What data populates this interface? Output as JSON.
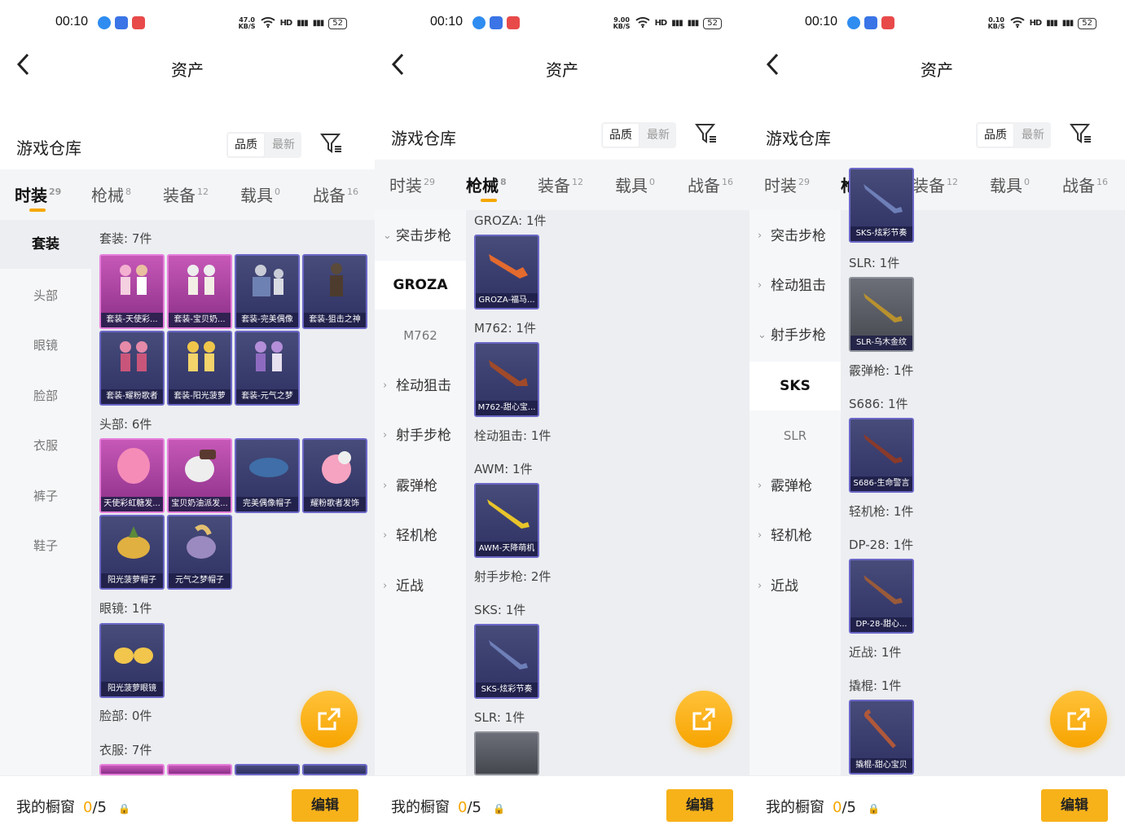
{
  "screens": [
    {
      "time": "00:10",
      "net": [
        "47.0",
        "KB/S"
      ],
      "battery": "52",
      "title": "资产",
      "warehouse": "游戏仓库",
      "sort": [
        "品质",
        "最新"
      ],
      "tabs": [
        {
          "label": "时装",
          "count": "29"
        },
        {
          "label": "枪械",
          "count": "8"
        },
        {
          "label": "装备",
          "count": "12"
        },
        {
          "label": "载具",
          "count": "0"
        },
        {
          "label": "战备",
          "count": "16"
        }
      ],
      "sidebar": [
        "套装",
        "头部",
        "眼镜",
        "脸部",
        "衣服",
        "裤子",
        "鞋子"
      ],
      "sections": [
        "套装: 7件",
        "头部: 6件",
        "眼镜: 1件",
        "脸部: 0件",
        "衣服: 7件"
      ],
      "cards": [
        "套装-天使彩...",
        "套装-宝贝奶...",
        "套装-完美偶像",
        "套装-狙击之神",
        "套装-耀粉歌者",
        "套装-阳光菠萝",
        "套装-元气之梦",
        "天使彩虹糖发...",
        "宝贝奶油派发...",
        "完美偶像帽子",
        "耀粉歌者发饰",
        "阳光菠萝帽子",
        "元气之梦帽子",
        "阳光菠萝眼镜"
      ],
      "showcase": "我的橱窗",
      "showcase_count": "0",
      "showcase_total": "/5",
      "edit": "编辑"
    },
    {
      "time": "00:10",
      "net": [
        "9.00",
        "KB/S"
      ],
      "battery": "52",
      "title": "资产",
      "warehouse": "游戏仓库",
      "sort": [
        "品质",
        "最新"
      ],
      "tabs": [
        {
          "label": "时装",
          "count": "29"
        },
        {
          "label": "枪械",
          "count": "8"
        },
        {
          "label": "装备",
          "count": "12"
        },
        {
          "label": "载具",
          "count": "0"
        },
        {
          "label": "战备",
          "count": "16"
        }
      ],
      "sidebar": [
        "突击步枪",
        "GROZA",
        "M762",
        "栓动狙击",
        "射手步枪",
        "霰弹枪",
        "轻机枪",
        "近战"
      ],
      "sections": [
        "GROZA: 1件",
        "M762: 1件",
        "栓动狙击: 1件",
        "AWM: 1件",
        "射手步枪: 2件",
        "SKS: 1件",
        "SLR: 1件"
      ],
      "cards": [
        "GROZA-福马...",
        "M762-甜心宝...",
        "AWM-天降萌机",
        "SKS-炫彩节奏"
      ],
      "showcase": "我的橱窗",
      "showcase_count": "0",
      "showcase_total": "/5",
      "edit": "编辑"
    },
    {
      "time": "00:10",
      "net": [
        "0.10",
        "KB/S"
      ],
      "battery": "52",
      "title": "资产",
      "warehouse": "游戏仓库",
      "sort": [
        "品质",
        "最新"
      ],
      "tabs": [
        {
          "label": "时装",
          "count": "29"
        },
        {
          "label": "枪械",
          "count": "8"
        },
        {
          "label": "装备",
          "count": "12"
        },
        {
          "label": "载具",
          "count": "0"
        },
        {
          "label": "战备",
          "count": "16"
        }
      ],
      "sidebar": [
        "突击步枪",
        "栓动狙击",
        "射手步枪",
        "SKS",
        "SLR",
        "霰弹枪",
        "轻机枪",
        "近战"
      ],
      "sections": [
        "SLR: 1件",
        "霰弹枪: 1件",
        "S686: 1件",
        "轻机枪: 1件",
        "DP-28: 1件",
        "近战: 1件",
        "撬棍: 1件"
      ],
      "cards": [
        "SKS-炫彩节奏",
        "SLR-乌木金纹",
        "S686-生命警言",
        "DP-28-甜心...",
        "撬棍-甜心宝贝"
      ],
      "showcase": "我的橱窗",
      "showcase_count": "0",
      "showcase_total": "/5",
      "edit": "编辑"
    }
  ],
  "colors": {
    "accent": "#f5a700",
    "card_purple": "#474c7a",
    "card_pink": "#c758b8",
    "panel": "#eceef1"
  },
  "icons": [
    "back-arrow-icon",
    "filter-icon",
    "share-icon",
    "lock-icon",
    "wifi-icon",
    "signal-icon",
    "battery-icon"
  ]
}
